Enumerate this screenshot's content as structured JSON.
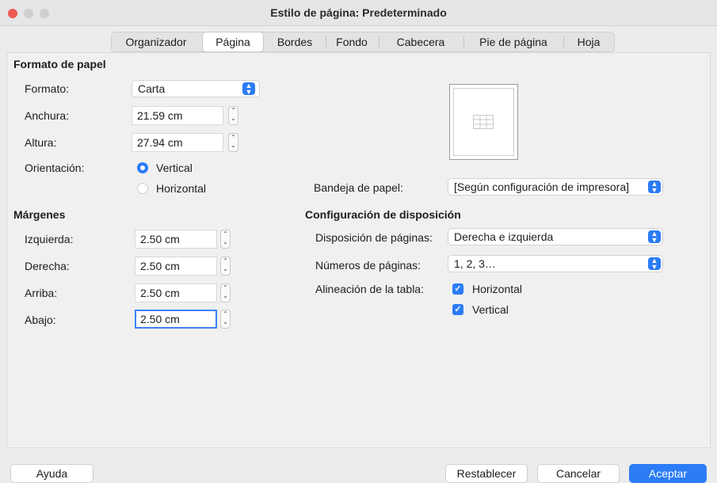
{
  "window": {
    "title": "Estilo de página: Predeterminado"
  },
  "tabs": [
    {
      "label": "Organizador"
    },
    {
      "label": "Página"
    },
    {
      "label": "Bordes"
    },
    {
      "label": "Fondo"
    },
    {
      "label": "Cabecera"
    },
    {
      "label": "Pie de página"
    },
    {
      "label": "Hoja"
    }
  ],
  "paper_format": {
    "heading": "Formato de papel",
    "format_label": "Formato:",
    "format_value": "Carta",
    "width_label": "Anchura:",
    "width_value": "21.59 cm",
    "height_label": "Altura:",
    "height_value": "27.94 cm",
    "orientation_label": "Orientación:",
    "orientation_vertical": "Vertical",
    "orientation_horizontal": "Horizontal",
    "orientation_selected": "Vertical",
    "tray_label": "Bandeja de papel:",
    "tray_value": "[Según configuración de impresora]"
  },
  "margins": {
    "heading": "Márgenes",
    "left_label": "Izquierda:",
    "left_value": "2.50 cm",
    "right_label": "Derecha:",
    "right_value": "2.50 cm",
    "top_label": "Arriba:",
    "top_value": "2.50 cm",
    "bottom_label": "Abajo:",
    "bottom_value": "2.50 cm"
  },
  "layout": {
    "heading": "Configuración de disposición",
    "page_layout_label": "Disposición de páginas:",
    "page_layout_value": "Derecha e izquierda",
    "page_numbers_label": "Números de páginas:",
    "page_numbers_value": "1, 2, 3…",
    "table_align_label": "Alineación de la tabla:",
    "align_horizontal": "Horizontal",
    "align_vertical": "Vertical",
    "align_horizontal_checked": true,
    "align_vertical_checked": true
  },
  "buttons": {
    "help": "Ayuda",
    "reset": "Restablecer",
    "cancel": "Cancelar",
    "ok": "Aceptar"
  },
  "colors": {
    "accent": "#2b7cf6",
    "close": "#ee5a52",
    "inactive_light": "#cfcfcf"
  },
  "icons": {
    "select": "chevron-updown-icon",
    "spin": "stepper-icon",
    "check": "checkmark-icon"
  }
}
